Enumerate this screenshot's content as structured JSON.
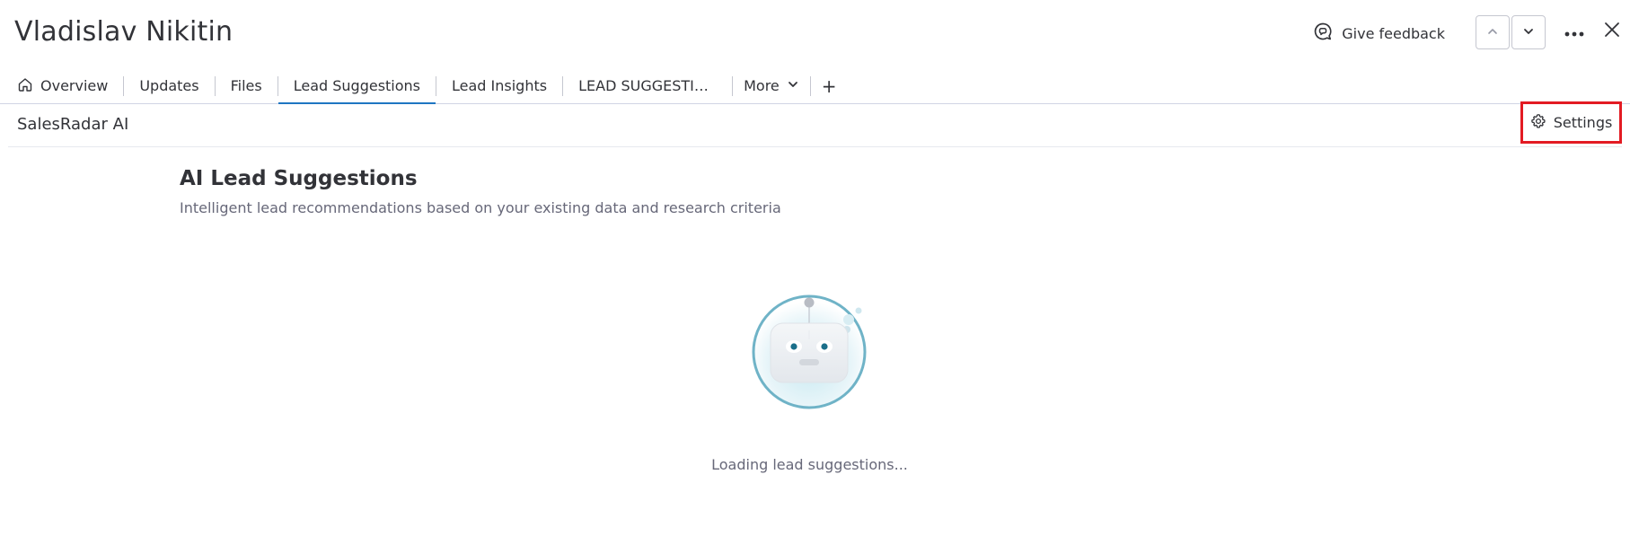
{
  "header": {
    "title": "Vladislav Nikitin",
    "feedback_label": "Give feedback",
    "icons": {
      "feedback": "chat-bubble-icon",
      "up": "chevron-up-icon",
      "down": "chevron-down-icon",
      "more": "more-dots-icon",
      "close": "close-icon"
    }
  },
  "tabs": {
    "items": [
      {
        "label": "Overview",
        "icon": "home-icon"
      },
      {
        "label": "Updates"
      },
      {
        "label": "Files"
      },
      {
        "label": "Lead Suggestions",
        "active": true
      },
      {
        "label": "Lead Insights"
      },
      {
        "label": "LEAD SUGGESTIO..."
      }
    ],
    "more_label": "More",
    "add_label": "+"
  },
  "subbar": {
    "app_name": "SalesRadar AI",
    "settings_label": "Settings"
  },
  "content": {
    "title": "AI Lead Suggestions",
    "subtitle": "Intelligent lead recommendations based on your existing data and research criteria",
    "loading_text": "Loading lead suggestions..."
  },
  "colors": {
    "accent_tab_underline": "#1f76c2",
    "highlight_border": "#e31b23",
    "robot_ring": "#6fb3c7"
  }
}
